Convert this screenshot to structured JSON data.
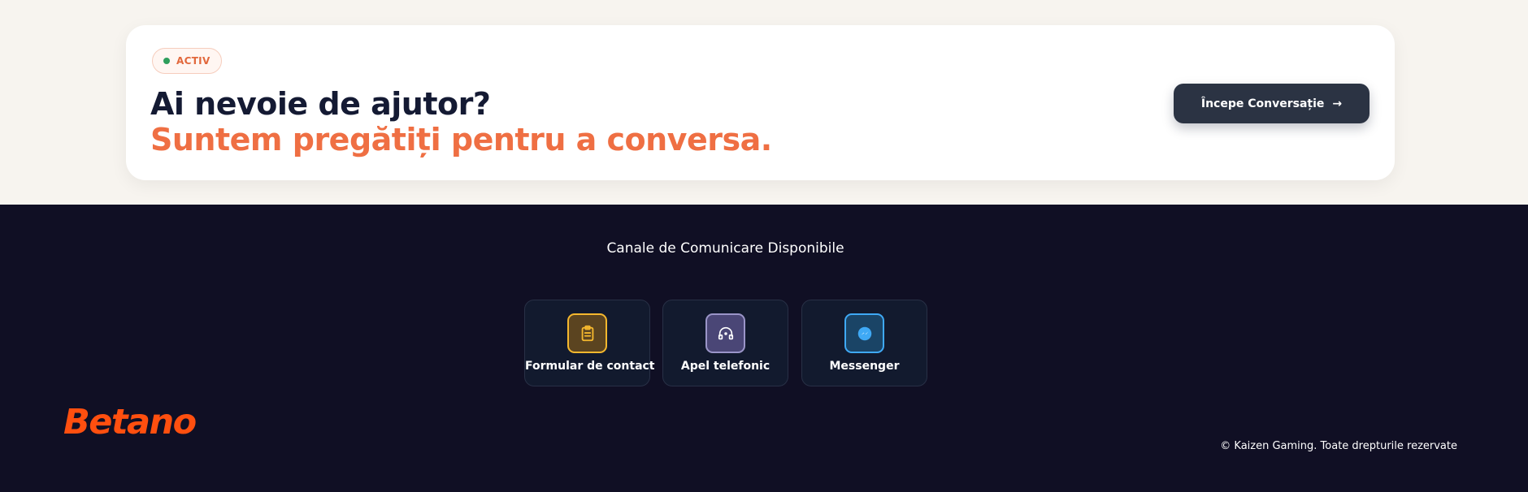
{
  "help_card": {
    "badge": "ACTIV",
    "title": "Ai nevoie de ajutor?",
    "subtitle": "Suntem pregătiți pentru a conversa.",
    "button_label": "Începe Conversație",
    "button_arrow": "→"
  },
  "footer": {
    "channels_title": "Canale de Comunicare Disponibile",
    "channels": [
      {
        "label": "Formular de contact",
        "icon": "clipboard-icon",
        "color": "#f5b82e"
      },
      {
        "label": "Apel telefonic",
        "icon": "headset-icon",
        "color": "#9a95c8"
      },
      {
        "label": "Messenger",
        "icon": "messenger-icon",
        "color": "#3fa9f5"
      }
    ],
    "logo": "Betano",
    "copyright": "© Kaizen Gaming. Toate drepturile rezervate"
  },
  "colors": {
    "accent": "#ef6f43",
    "logo": "#ff4f0f",
    "footer_background": "#100f24",
    "button_background": "#2b3343"
  }
}
